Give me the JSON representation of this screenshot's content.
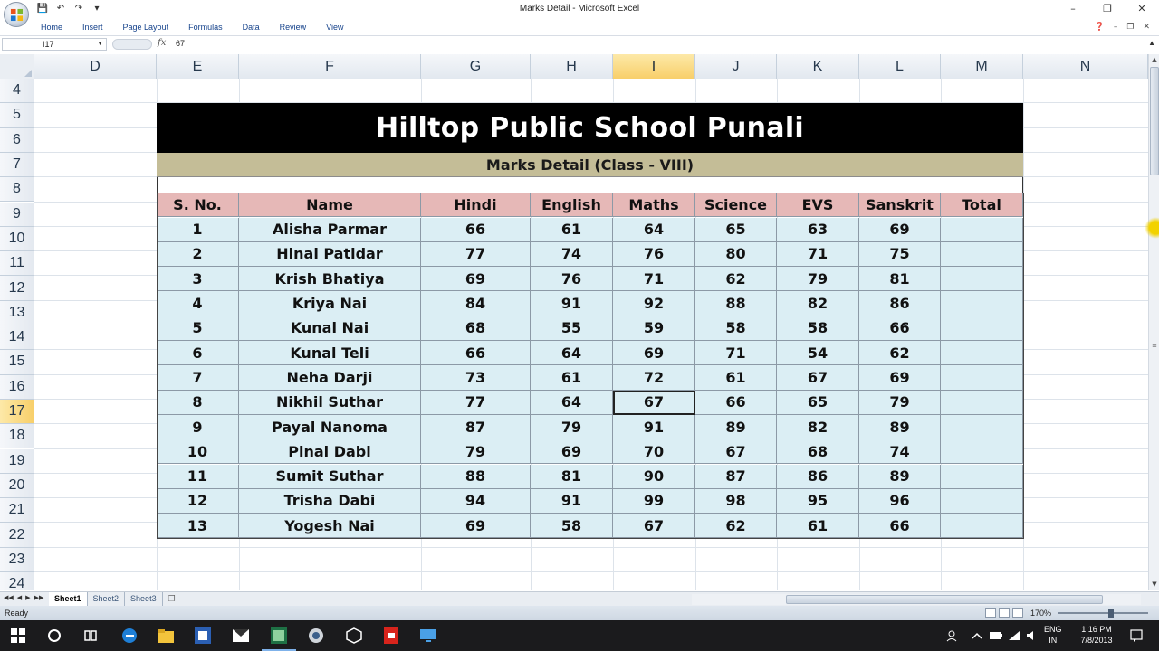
{
  "window": {
    "title": "Marks Detail - Microsoft Excel"
  },
  "ribbon": {
    "tabs": [
      "Home",
      "Insert",
      "Page Layout",
      "Formulas",
      "Data",
      "Review",
      "View"
    ]
  },
  "formula_bar": {
    "name_box": "I17",
    "fx_label": "fx",
    "value": "67"
  },
  "columns": [
    "D",
    "E",
    "F",
    "G",
    "H",
    "I",
    "J",
    "K",
    "L",
    "M",
    "N"
  ],
  "selected_column": "I",
  "rows": [
    "4",
    "5",
    "6",
    "7",
    "8",
    "9",
    "10",
    "11",
    "12",
    "13",
    "14",
    "15",
    "16",
    "17",
    "18",
    "19",
    "20",
    "21",
    "22",
    "23",
    "24"
  ],
  "selected_row": "17",
  "sheet": {
    "school_title": "Hilltop Public School Punali",
    "subtitle": "Marks Detail (Class - VIII)",
    "headers": [
      "S. No.",
      "Name",
      "Hindi",
      "English",
      "Maths",
      "Science",
      "EVS",
      "Sanskrit",
      "Total"
    ],
    "students": [
      [
        "1",
        "Alisha Parmar",
        "66",
        "61",
        "64",
        "65",
        "63",
        "69",
        ""
      ],
      [
        "2",
        "Hinal Patidar",
        "77",
        "74",
        "76",
        "80",
        "71",
        "75",
        ""
      ],
      [
        "3",
        "Krish Bhatiya",
        "69",
        "76",
        "71",
        "62",
        "79",
        "81",
        ""
      ],
      [
        "4",
        "Kriya Nai",
        "84",
        "91",
        "92",
        "88",
        "82",
        "86",
        ""
      ],
      [
        "5",
        "Kunal Nai",
        "68",
        "55",
        "59",
        "58",
        "58",
        "66",
        ""
      ],
      [
        "6",
        "Kunal Teli",
        "66",
        "64",
        "69",
        "71",
        "54",
        "62",
        ""
      ],
      [
        "7",
        "Neha Darji",
        "73",
        "61",
        "72",
        "61",
        "67",
        "69",
        ""
      ],
      [
        "8",
        "Nikhil Suthar",
        "77",
        "64",
        "67",
        "66",
        "65",
        "79",
        ""
      ],
      [
        "9",
        "Payal Nanoma",
        "87",
        "79",
        "91",
        "89",
        "82",
        "89",
        ""
      ],
      [
        "10",
        "Pinal Dabi",
        "79",
        "69",
        "70",
        "67",
        "68",
        "74",
        ""
      ],
      [
        "11",
        "Sumit Suthar",
        "88",
        "81",
        "90",
        "87",
        "86",
        "89",
        ""
      ],
      [
        "12",
        "Trisha Dabi",
        "94",
        "91",
        "99",
        "98",
        "95",
        "96",
        ""
      ],
      [
        "13",
        "Yogesh Nai",
        "69",
        "58",
        "67",
        "62",
        "61",
        "66",
        ""
      ]
    ]
  },
  "sheet_tabs": [
    "Sheet1",
    "Sheet2",
    "Sheet3"
  ],
  "active_sheet": "Sheet1",
  "status": {
    "ready": "Ready",
    "zoom": "170%"
  },
  "taskbar": {
    "lang_top": "ENG",
    "lang_bottom": "IN",
    "time": "1:16 PM",
    "date": "7/8/2013"
  },
  "colors": {
    "header_fill": "#e6b8b7",
    "body_fill": "#dbeef4",
    "subtitle_fill": "#c4bd97",
    "banner_fill": "#000000"
  }
}
